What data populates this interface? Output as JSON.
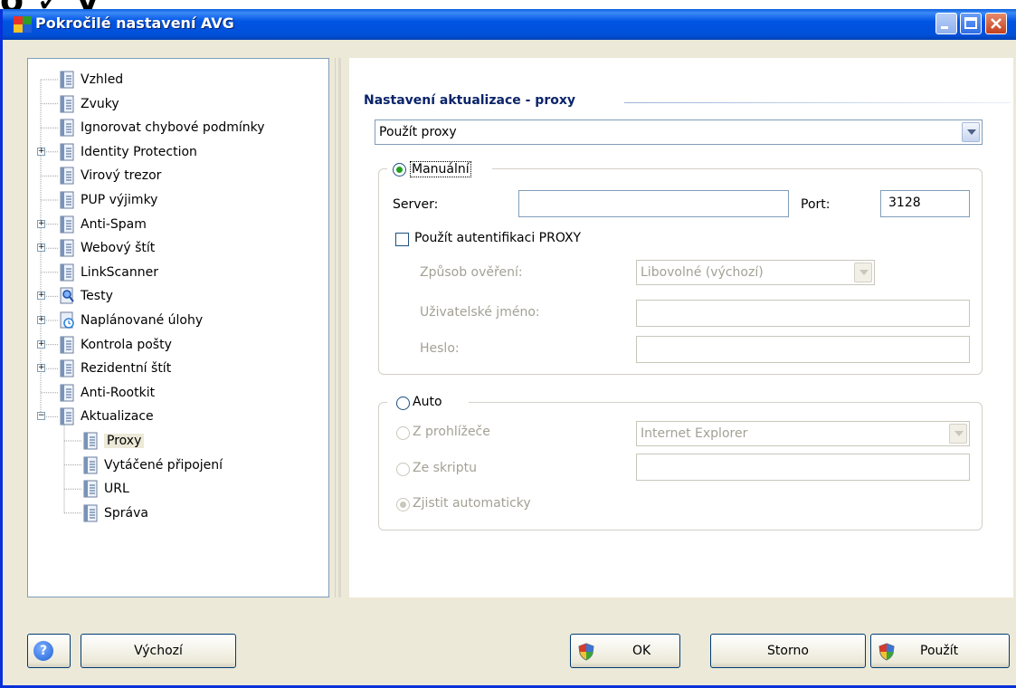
{
  "top_clip_text": "o ✓ y",
  "window": {
    "title": "Pokročilé nastavení AVG"
  },
  "tree": {
    "items": [
      {
        "label": "Vzhled",
        "level": 0,
        "expander": "",
        "icon": "page-icon"
      },
      {
        "label": "Zvuky",
        "level": 0,
        "expander": "",
        "icon": "page-icon"
      },
      {
        "label": "Ignorovat chybové podmínky",
        "level": 0,
        "expander": "",
        "icon": "page-icon"
      },
      {
        "label": "Identity Protection",
        "level": 0,
        "expander": "+",
        "icon": "page-icon"
      },
      {
        "label": "Virový trezor",
        "level": 0,
        "expander": "",
        "icon": "page-icon"
      },
      {
        "label": "PUP výjimky",
        "level": 0,
        "expander": "",
        "icon": "page-icon"
      },
      {
        "label": "Anti-Spam",
        "level": 0,
        "expander": "+",
        "icon": "page-icon"
      },
      {
        "label": "Webový štít",
        "level": 0,
        "expander": "+",
        "icon": "page-icon"
      },
      {
        "label": "LinkScanner",
        "level": 0,
        "expander": "",
        "icon": "page-icon"
      },
      {
        "label": "Testy",
        "level": 0,
        "expander": "+",
        "icon": "magnifier-icon"
      },
      {
        "label": "Naplánované úlohy",
        "level": 0,
        "expander": "+",
        "icon": "scheduler-icon"
      },
      {
        "label": "Kontrola pošty",
        "level": 0,
        "expander": "+",
        "icon": "page-icon"
      },
      {
        "label": "Rezidentní štít",
        "level": 0,
        "expander": "+",
        "icon": "page-icon"
      },
      {
        "label": "Anti-Rootkit",
        "level": 0,
        "expander": "",
        "icon": "page-icon"
      },
      {
        "label": "Aktualizace",
        "level": 0,
        "expander": "-",
        "icon": "page-icon"
      },
      {
        "label": "Proxy",
        "level": 1,
        "expander": "",
        "icon": "page-icon",
        "selected": true
      },
      {
        "label": "Vytáčené připojení",
        "level": 1,
        "expander": "",
        "icon": "page-icon"
      },
      {
        "label": "URL",
        "level": 1,
        "expander": "",
        "icon": "page-icon"
      },
      {
        "label": "Správa",
        "level": 1,
        "expander": "",
        "icon": "page-icon"
      }
    ]
  },
  "proxy": {
    "section_title": "Nastavení aktualizace - proxy",
    "mode_select": "Použít proxy",
    "manual": {
      "label": "Manuální",
      "selected": true,
      "server_label": "Server:",
      "server_value": "",
      "port_label": "Port:",
      "port_value": "3128",
      "auth_checkbox_label": "Použít autentifikaci PROXY",
      "auth_checked": false,
      "auth_method_label": "Způsob ověření:",
      "auth_method_value": "Libovolné (výchozí)",
      "username_label": "Uživatelské jméno:",
      "username_value": "",
      "password_label": "Heslo:",
      "password_value": ""
    },
    "auto": {
      "label": "Auto",
      "selected": false,
      "browser_label": "Z prohlížeče",
      "browser_value": "Internet Explorer",
      "script_label": "Ze skriptu",
      "script_value": "",
      "detect_label": "Zjistit automaticky",
      "detect_selected": true
    }
  },
  "footer": {
    "help_glyph": "?",
    "default_label": "Výchozí",
    "ok_label": "OK",
    "cancel_label": "Storno",
    "apply_label": "Použít"
  },
  "colors": {
    "titlebar": "#0054e3",
    "window_bg": "#ece9d8",
    "section_title": "#0a246a",
    "radio_dot": "#21a121"
  }
}
